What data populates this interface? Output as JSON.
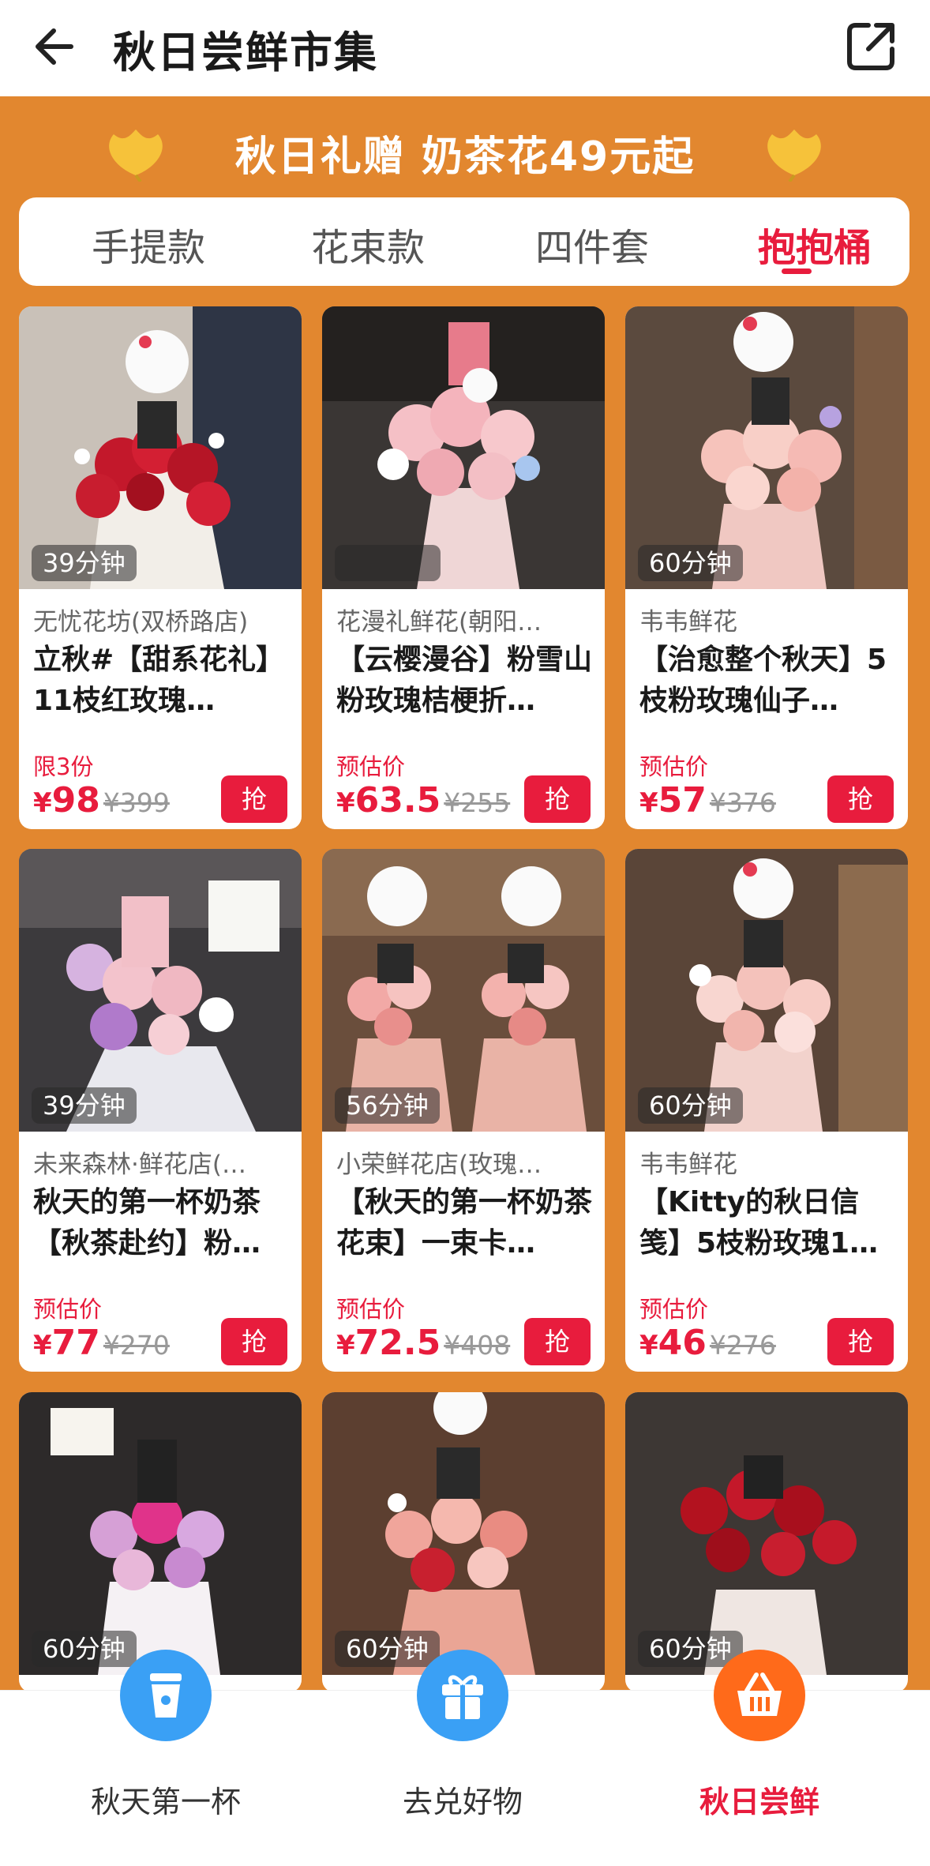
{
  "header": {
    "title": "秋日尝鲜市集",
    "back_icon": "back-arrow-icon",
    "share_icon": "share-icon"
  },
  "banner": {
    "title": "秋日礼赠 奶茶花49元起",
    "leaf_icon": "ginkgo-leaf-icon"
  },
  "tabs": [
    {
      "label": "手提款",
      "active": false
    },
    {
      "label": "花束款",
      "active": false
    },
    {
      "label": "四件套",
      "active": false
    },
    {
      "label": "抱抱桶",
      "active": true
    }
  ],
  "products": [
    {
      "time": "39分钟",
      "shop": "无忧花坊(双桥路店)",
      "name": "立秋#【甜系花礼】11枝红玫瑰…",
      "price_label": "限3份",
      "currency": "¥",
      "price": "98",
      "original": "¥399",
      "button": "抢"
    },
    {
      "time": "",
      "shop": "花漫礼鲜花(朝阳…",
      "name": "【云樱漫谷】粉雪山粉玫瑰桔梗折…",
      "price_label": "预估价",
      "currency": "¥",
      "price": "63.5",
      "original": "¥255",
      "button": "抢"
    },
    {
      "time": "60分钟",
      "shop": "韦韦鲜花",
      "name": "【治愈整个秋天】5枝粉玫瑰仙子…",
      "price_label": "预估价",
      "currency": "¥",
      "price": "57",
      "original": "¥376",
      "button": "抢"
    },
    {
      "time": "39分钟",
      "shop": "未来森林·鲜花店(…",
      "name": "秋天的第一杯奶茶【秋茶赴约】粉…",
      "price_label": "预估价",
      "currency": "¥",
      "price": "77",
      "original": "¥270",
      "button": "抢"
    },
    {
      "time": "56分钟",
      "shop": "小荣鲜花店(玫瑰…",
      "name": "【秋天的第一杯奶茶花束】一束卡…",
      "price_label": "预估价",
      "currency": "¥",
      "price": "72.5",
      "original": "¥408",
      "button": "抢"
    },
    {
      "time": "60分钟",
      "shop": "韦韦鲜花",
      "name": "【Kitty的秋日信笺】5枝粉玫瑰1…",
      "price_label": "预估价",
      "currency": "¥",
      "price": "46",
      "original": "¥276",
      "button": "抢"
    },
    {
      "time": "60分钟"
    },
    {
      "time": "60分钟"
    },
    {
      "time": "60分钟"
    }
  ],
  "bottom_nav": [
    {
      "label": "秋天第一杯",
      "icon": "milk-tea-cup-icon",
      "color": "#3aa0f5",
      "active": false
    },
    {
      "label": "去兑好物",
      "icon": "gift-icon",
      "color": "#3aa0f5",
      "active": false
    },
    {
      "label": "秋日尝鲜",
      "icon": "basket-icon",
      "color": "#ff6a1a",
      "active": true
    }
  ],
  "colors": {
    "accent": "#e81c3d",
    "orange_bg": "#e2872f"
  }
}
